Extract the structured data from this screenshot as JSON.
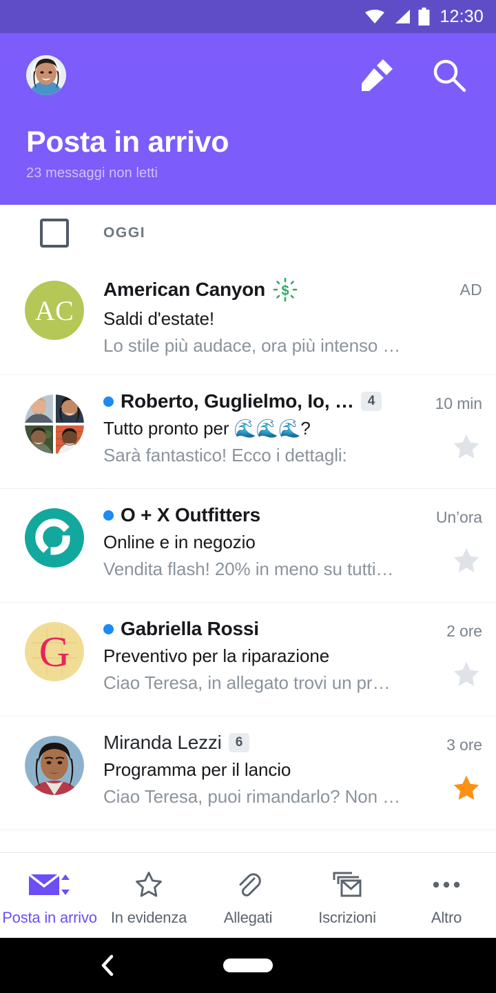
{
  "statusbar": {
    "time": "12:30",
    "wifi_icon": "wifi-icon",
    "signal_icon": "signal-icon",
    "battery_icon": "battery-icon"
  },
  "header": {
    "title": "Posta in arrivo",
    "subtitle": "23 messaggi non letti",
    "avatar_name": "user-avatar",
    "compose_label": "compose-icon",
    "search_label": "search-icon",
    "bg_color": "#7c5cfa",
    "statusbar_color": "#5f4dc7"
  },
  "list": {
    "section_label": "OGGI",
    "select_all_checkbox": "unchecked",
    "messages": [
      {
        "sender": "American Canyon",
        "subject": "Saldi d'estate!",
        "preview": "Lo stile più audace, ora più intenso che …",
        "time": "AD",
        "is_ad": true,
        "unread": false,
        "starred": false,
        "count": null,
        "deal_icon": "deal-dollar-icon",
        "avatar": {
          "type": "initials",
          "text": "AC",
          "color": "#b5c756"
        }
      },
      {
        "sender": "Roberto, Guglielmo, Io, …",
        "subject": "Tutto pronto per 🌊🌊🌊?",
        "preview": "Sarà fantastico! Ecco i dettagli:",
        "time": "10 min",
        "is_ad": false,
        "unread": true,
        "starred": false,
        "count": "4",
        "deal_icon": null,
        "avatar": {
          "type": "group",
          "color": "#c8ced6"
        }
      },
      {
        "sender": "O + X Outfitters",
        "subject": "Online e in negozio",
        "preview": "Vendita flash! 20% in meno su tutti…",
        "time": "Un’ora",
        "is_ad": false,
        "unread": true,
        "starred": false,
        "count": null,
        "deal_icon": null,
        "avatar": {
          "type": "logo-arc",
          "text": "",
          "color": "#13a89e"
        }
      },
      {
        "sender": "Gabriella Rossi",
        "subject": "Preventivo per la riparazione",
        "preview": "Ciao Teresa, in allegato trovi un pr…",
        "time": "2 ore",
        "is_ad": false,
        "unread": true,
        "starred": false,
        "count": null,
        "deal_icon": null,
        "avatar": {
          "type": "monogram",
          "text": "G",
          "color": "#f0dc94"
        }
      },
      {
        "sender": "Miranda Lezzi",
        "subject": "Programma per il lancio",
        "preview": "Ciao Teresa, puoi rimandarlo? Non …",
        "time": "3 ore",
        "is_ad": false,
        "unread": false,
        "starred": true,
        "count": "6",
        "deal_icon": null,
        "avatar": {
          "type": "photo",
          "color": "#86a9c4"
        }
      }
    ]
  },
  "bottomnav": {
    "active_index": 0,
    "items": [
      {
        "label": "Posta in arrivo",
        "icon": "inbox-envelope-icon"
      },
      {
        "label": "In evidenza",
        "icon": "star-outline-icon"
      },
      {
        "label": "Allegati",
        "icon": "paperclip-icon"
      },
      {
        "label": "Iscrizioni",
        "icon": "subscriptions-icon"
      },
      {
        "label": "Altro",
        "icon": "more-dots-icon"
      }
    ]
  },
  "sysnav": {
    "back_icon": "back-chevron-icon",
    "home_icon": "home-pill-icon"
  },
  "colors": {
    "accent": "#6b4ef5",
    "unread_dot": "#1b8cf3",
    "star_on": "#fb9116",
    "star_off": "#dfe3e8"
  }
}
